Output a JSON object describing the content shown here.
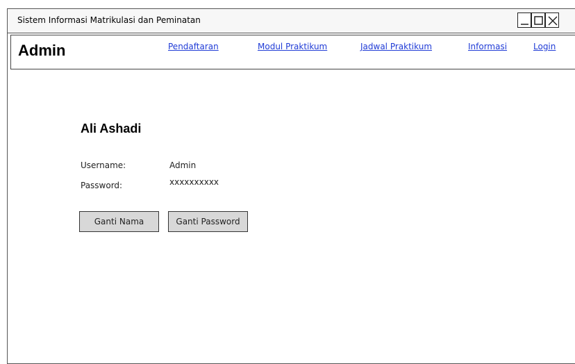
{
  "window": {
    "title": "Sistem Informasi Matrikulasi dan Peminatan"
  },
  "navbar": {
    "brand": "Admin",
    "links": [
      {
        "label": "Pendaftaran"
      },
      {
        "label": "Modul Praktikum"
      },
      {
        "label": "Jadwal Praktikum"
      },
      {
        "label": "Informasi"
      },
      {
        "label": "Login"
      }
    ],
    "link_color": "#1f3bd6"
  },
  "profile": {
    "name": "Ali Ashadi",
    "username_label": "Username:",
    "username_value": "Admin",
    "password_label": "Password:",
    "password_value": "xxxxxxxxxx"
  },
  "actions": {
    "change_name": "Ganti Nama",
    "change_password": "Ganti Password"
  },
  "icons": [
    "minimize-icon",
    "maximize-icon",
    "close-icon"
  ]
}
